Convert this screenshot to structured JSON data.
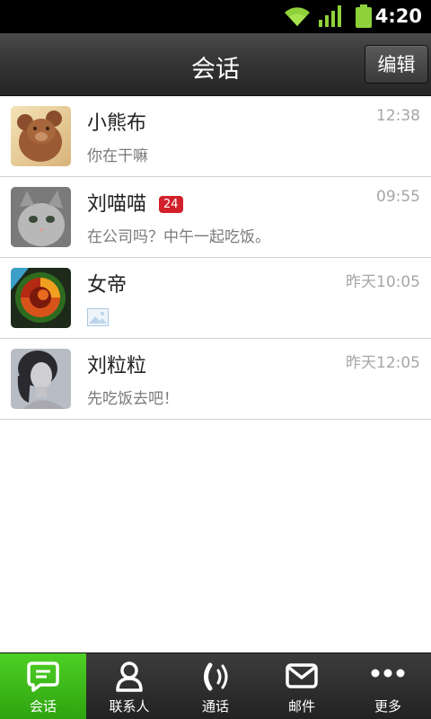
{
  "status_bar": {
    "time": "4:20"
  },
  "header": {
    "title": "会话",
    "edit_label": "编辑"
  },
  "conversations": [
    {
      "name": "小熊布",
      "time": "12:38",
      "message": "你在干嘛",
      "badge": ""
    },
    {
      "name": "刘喵喵",
      "time": "09:55",
      "message": "在公司吗？中午一起吃饭。",
      "badge": "24"
    },
    {
      "name": "女帝",
      "time": "昨天10:05",
      "message": "",
      "badge": ""
    },
    {
      "name": "刘粒粒",
      "time": "昨天12:05",
      "message": "先吃饭去吧！",
      "badge": ""
    }
  ],
  "tabs": [
    {
      "label": "会话",
      "icon": "chat-bubble-icon",
      "active": true
    },
    {
      "label": "联系人",
      "icon": "person-icon",
      "active": false
    },
    {
      "label": "通话",
      "icon": "phone-icon",
      "active": false
    },
    {
      "label": "邮件",
      "icon": "mail-icon",
      "active": false
    },
    {
      "label": "更多",
      "icon": "more-dots-icon",
      "active": false
    }
  ],
  "colors": {
    "accent": "#3fbf1a",
    "badge": "#d3212b"
  }
}
